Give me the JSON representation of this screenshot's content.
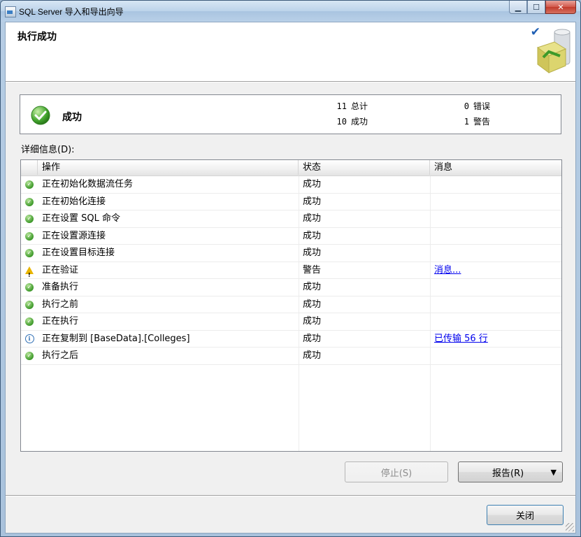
{
  "window": {
    "title": "SQL Server 导入和导出向导"
  },
  "page": {
    "title": "执行成功"
  },
  "summary": {
    "status_label": "成功",
    "total_count": "11",
    "total_label": "总计",
    "success_count": "10",
    "success_label": "成功",
    "error_count": "0",
    "error_label": "错误",
    "warning_count": "1",
    "warning_label": "警告"
  },
  "details": {
    "label": "详细信息(D):",
    "columns": [
      "操作",
      "状态",
      "消息"
    ],
    "rows": [
      {
        "icon": "success-icon",
        "action": "正在初始化数据流任务",
        "status": "成功",
        "message": ""
      },
      {
        "icon": "success-icon",
        "action": "正在初始化连接",
        "status": "成功",
        "message": ""
      },
      {
        "icon": "success-icon",
        "action": "正在设置 SQL 命令",
        "status": "成功",
        "message": ""
      },
      {
        "icon": "success-icon",
        "action": "正在设置源连接",
        "status": "成功",
        "message": ""
      },
      {
        "icon": "success-icon",
        "action": "正在设置目标连接",
        "status": "成功",
        "message": ""
      },
      {
        "icon": "warning-icon",
        "action": "正在验证",
        "status": "警告",
        "message": "消息..."
      },
      {
        "icon": "success-icon",
        "action": "准备执行",
        "status": "成功",
        "message": ""
      },
      {
        "icon": "success-icon",
        "action": "执行之前",
        "status": "成功",
        "message": ""
      },
      {
        "icon": "success-icon",
        "action": "正在执行",
        "status": "成功",
        "message": ""
      },
      {
        "icon": "info-icon",
        "action": "正在复制到 [BaseData].[Colleges]",
        "status": "成功",
        "message": "已传输 56 行"
      },
      {
        "icon": "success-icon",
        "action": "执行之后",
        "status": "成功",
        "message": ""
      }
    ]
  },
  "buttons": {
    "stop": "停止(S)",
    "report": "报告(R)",
    "close": "关闭"
  },
  "colors": {
    "link": "#0000ee",
    "success": "#3e9a2a",
    "warning": "#e8b400"
  }
}
